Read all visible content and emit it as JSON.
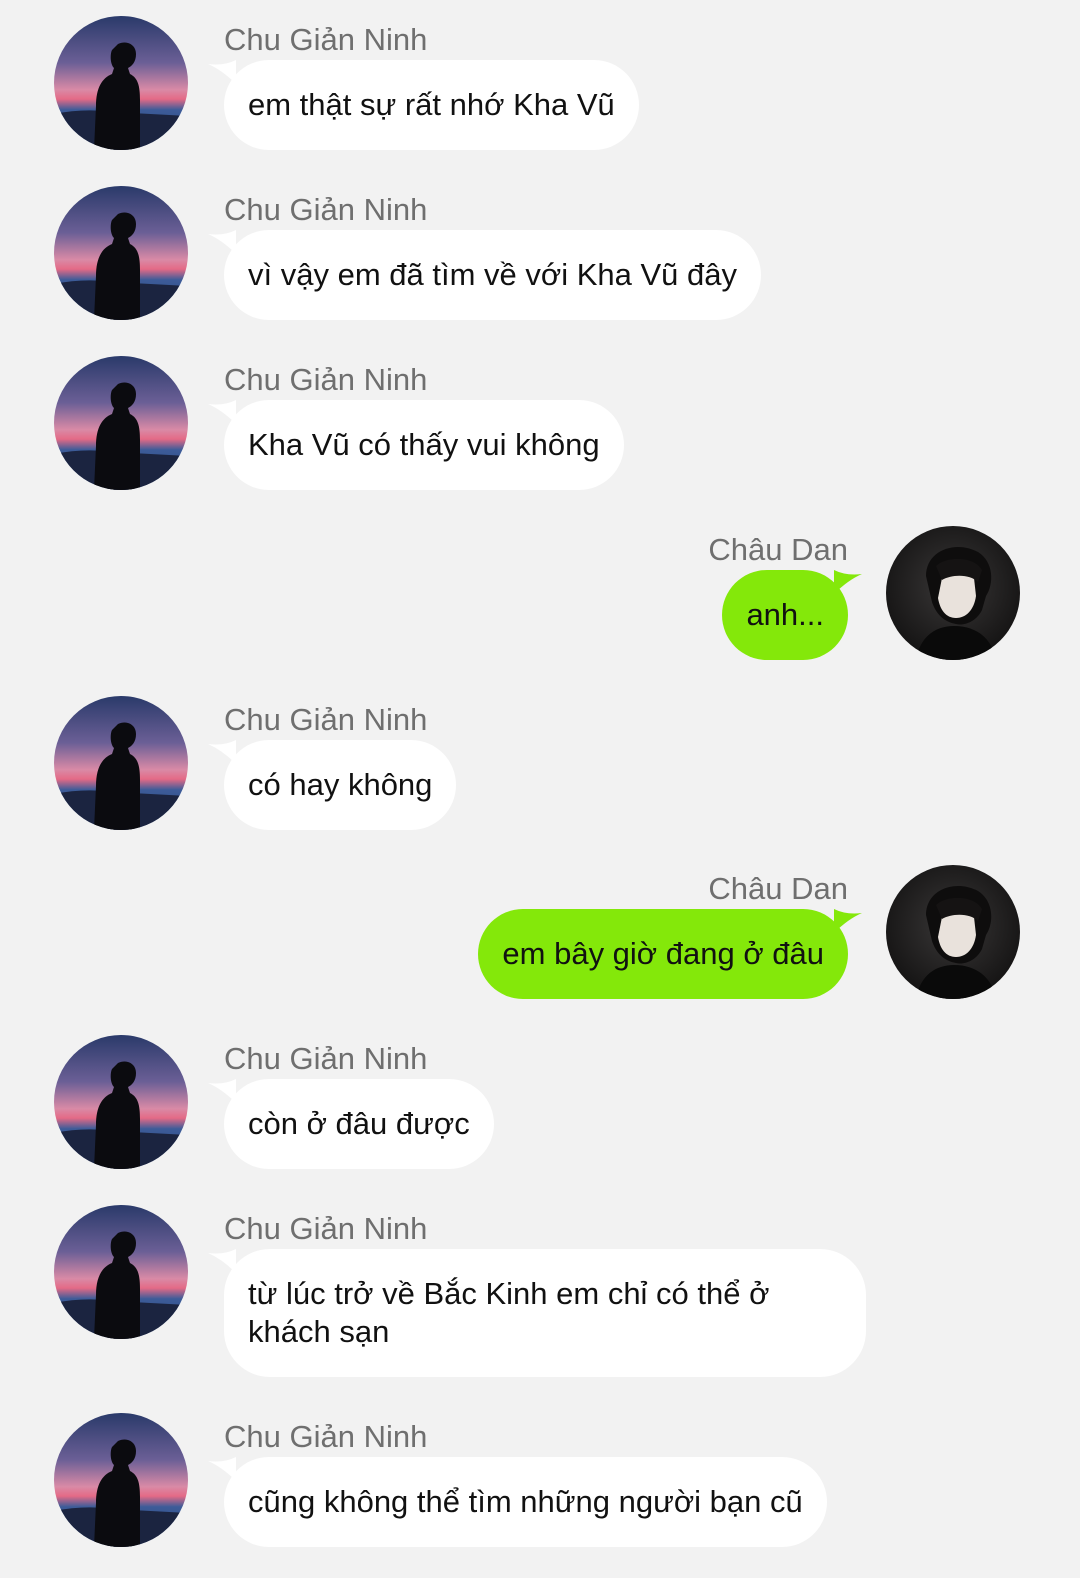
{
  "colors": {
    "background": "#f2f2f2",
    "incoming_bubble": "#ffffff",
    "outgoing_bubble": "#84e80a",
    "sender_name": "#6f6f6f"
  },
  "messages": [
    {
      "sender": "Chu Giản Ninh",
      "text": "em thật sự rất nhớ Kha Vũ",
      "side": "left",
      "avatar": "silhouette-sunset-avatar"
    },
    {
      "sender": "Chu Giản Ninh",
      "text": "vì vậy em đã tìm về với Kha Vũ đây",
      "side": "left",
      "avatar": "silhouette-sunset-avatar"
    },
    {
      "sender": "Chu Giản Ninh",
      "text": "Kha Vũ có thấy vui không",
      "side": "left",
      "avatar": "silhouette-sunset-avatar"
    },
    {
      "sender": "Châu Dan",
      "text": "anh...",
      "side": "right",
      "avatar": "dark-portrait-avatar"
    },
    {
      "sender": "Chu Giản Ninh",
      "text": "có hay không",
      "side": "left",
      "avatar": "silhouette-sunset-avatar"
    },
    {
      "sender": "Châu Dan",
      "text": "em bây giờ đang ở đâu",
      "side": "right",
      "avatar": "dark-portrait-avatar"
    },
    {
      "sender": "Chu Giản Ninh",
      "text": "còn ở đâu được",
      "side": "left",
      "avatar": "silhouette-sunset-avatar"
    },
    {
      "sender": "Chu Giản Ninh",
      "text": "từ lúc trở về Bắc Kinh em chỉ có thể ở khách sạn",
      "side": "left",
      "avatar": "silhouette-sunset-avatar"
    },
    {
      "sender": "Chu Giản Ninh",
      "text": "cũng không thể tìm những người bạn cũ",
      "side": "left",
      "avatar": "silhouette-sunset-avatar"
    }
  ]
}
